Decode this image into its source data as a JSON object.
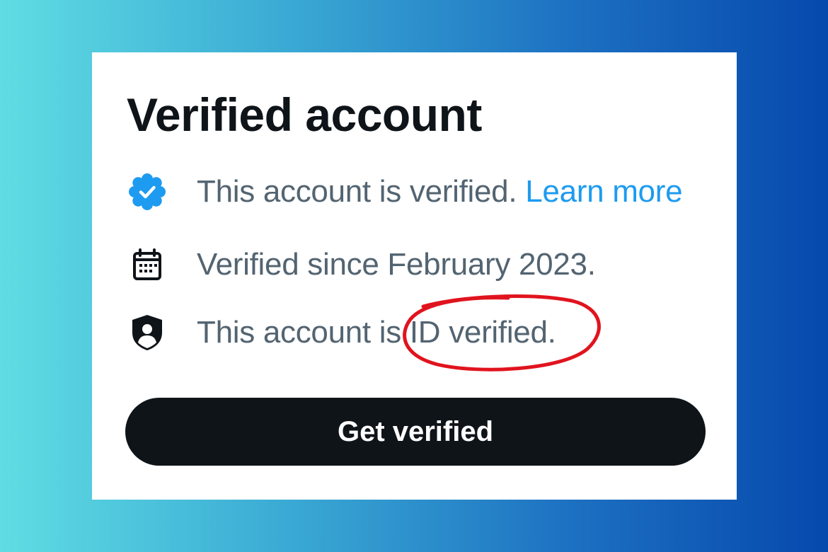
{
  "colors": {
    "background_gradient": [
      "#5fdde3",
      "#3aa9d4",
      "#1c6fc1",
      "#0649ad"
    ],
    "card": "#ffffff",
    "title": "#0f1419",
    "body_text": "#536471",
    "link": "#1d9bf0",
    "badge": "#1d9bf0",
    "button_bg": "#0f1419",
    "button_text": "#ffffff",
    "annotation": "#e0141e"
  },
  "panel": {
    "title": "Verified account",
    "rows": [
      {
        "icon": "verified-badge-icon",
        "text": "This account is verified.",
        "link": "Learn more"
      },
      {
        "icon": "calendar-icon",
        "text": "Verified since February 2023."
      },
      {
        "icon": "id-shield-icon",
        "text": "This account is ID verified.",
        "annotation": "red-circle-highlight"
      }
    ],
    "button_label": "Get verified"
  }
}
